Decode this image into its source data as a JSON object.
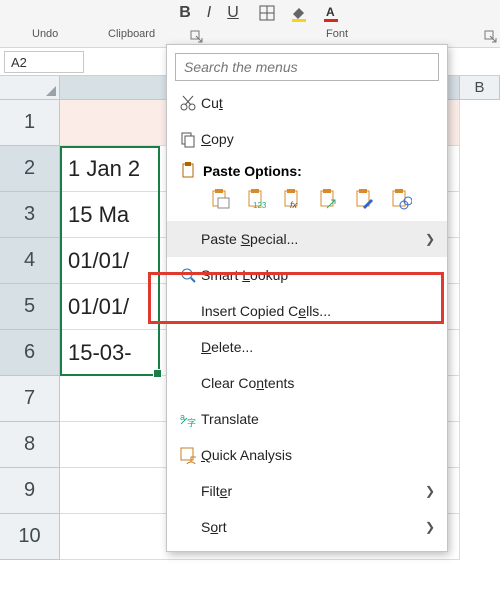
{
  "ribbon": {
    "groups": {
      "undo": "Undo",
      "clipboard": "Clipboard",
      "font": "Font"
    },
    "font_buttons": [
      "B",
      "I",
      "U"
    ]
  },
  "namebox": {
    "value": "A2"
  },
  "columns": {
    "A_partial": "",
    "B": "B"
  },
  "rows": [
    {
      "n": "1",
      "v": "",
      "sel": false,
      "a1": true
    },
    {
      "n": "2",
      "v": "1 Jan 2",
      "sel": true
    },
    {
      "n": "3",
      "v": "15 Ma",
      "sel": true
    },
    {
      "n": "4",
      "v": "01/01/",
      "sel": true
    },
    {
      "n": "5",
      "v": "01/01/",
      "sel": true
    },
    {
      "n": "6",
      "v": "15-03-",
      "sel": true
    },
    {
      "n": "7",
      "v": "",
      "sel": false
    },
    {
      "n": "8",
      "v": "",
      "sel": false
    },
    {
      "n": "9",
      "v": "",
      "sel": false
    },
    {
      "n": "10",
      "v": "",
      "sel": false
    }
  ],
  "menu": {
    "search_placeholder": "Search the menus",
    "cut": "Cut",
    "copy": "Copy",
    "paste_header": "Paste Options:",
    "paste_special": "Paste Special...",
    "smart_lookup": "Smart Lookup",
    "insert_copied": "Insert Copied Cells...",
    "delete": "Delete...",
    "clear_contents": "Clear Contents",
    "translate": "Translate",
    "quick_analysis": "Quick Analysis",
    "filter": "Filter",
    "sort": "Sort"
  }
}
